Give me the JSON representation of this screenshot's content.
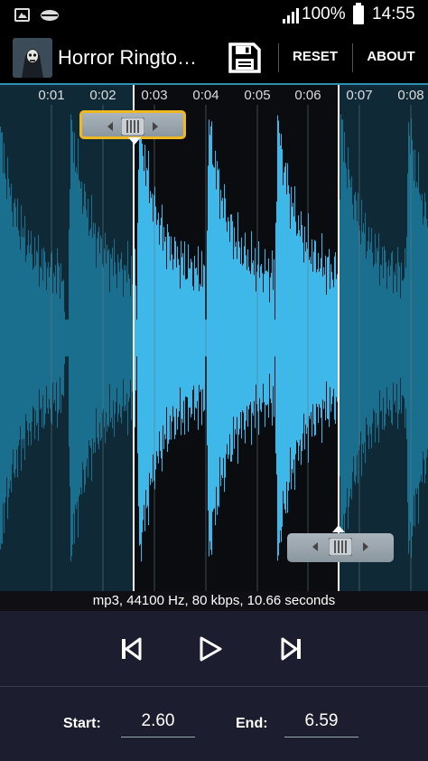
{
  "status_bar": {
    "battery": "100%",
    "time": "14:55",
    "icons": [
      "image-notification-icon",
      "cloud-icon",
      "signal-icon",
      "battery-icon"
    ]
  },
  "action_bar": {
    "title": "Horror Ringto…",
    "reset_label": "RESET",
    "about_label": "ABOUT",
    "icons": [
      "app-icon",
      "save-icon"
    ]
  },
  "waveform": {
    "ticks": [
      "0:01",
      "0:02",
      "0:03",
      "0:04",
      "0:05",
      "0:06",
      "0:07",
      "0:08"
    ],
    "colors": {
      "selected": "#3db8e8",
      "unselected": "#1a6f8e",
      "bg_selected": "#0a0c10",
      "bg_unselected": "#0f2a36"
    }
  },
  "file_info": "mp3, 44100 Hz, 80 kbps, 10.66 seconds",
  "transport": {
    "icons": [
      "skip-previous-icon",
      "play-icon",
      "skip-next-icon"
    ]
  },
  "range": {
    "start_label": "Start:",
    "start_value": "2.60",
    "end_label": "End:",
    "end_value": "6.59"
  }
}
